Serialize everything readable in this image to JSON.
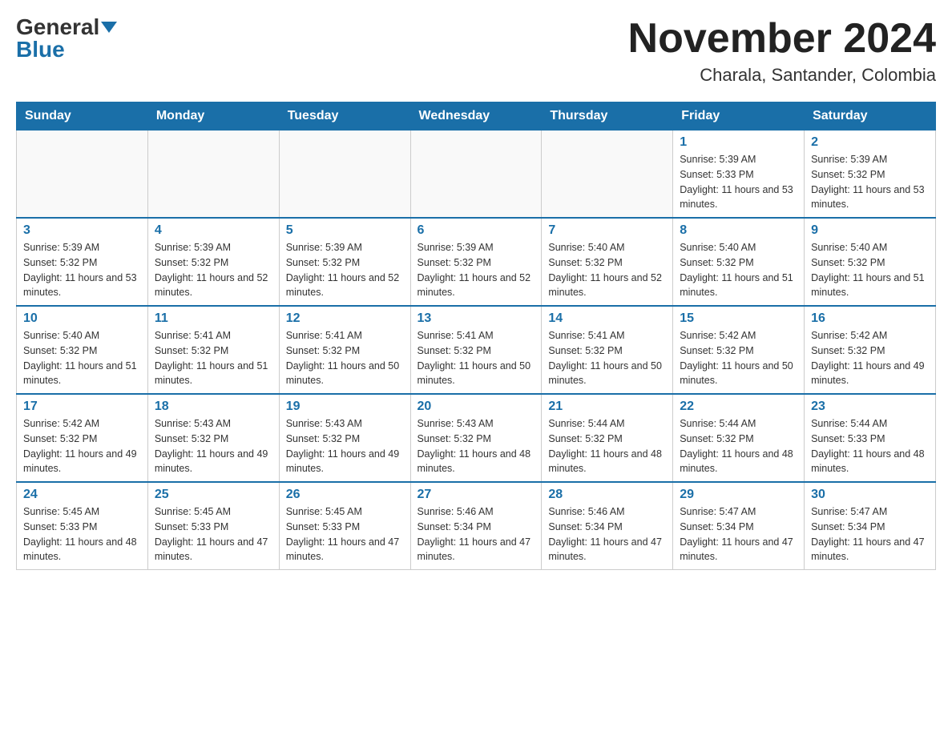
{
  "header": {
    "logo_general": "General",
    "logo_blue": "Blue",
    "month_title": "November 2024",
    "location": "Charala, Santander, Colombia"
  },
  "days_of_week": [
    "Sunday",
    "Monday",
    "Tuesday",
    "Wednesday",
    "Thursday",
    "Friday",
    "Saturday"
  ],
  "weeks": [
    [
      {
        "day": "",
        "info": ""
      },
      {
        "day": "",
        "info": ""
      },
      {
        "day": "",
        "info": ""
      },
      {
        "day": "",
        "info": ""
      },
      {
        "day": "",
        "info": ""
      },
      {
        "day": "1",
        "info": "Sunrise: 5:39 AM\nSunset: 5:33 PM\nDaylight: 11 hours and 53 minutes."
      },
      {
        "day": "2",
        "info": "Sunrise: 5:39 AM\nSunset: 5:32 PM\nDaylight: 11 hours and 53 minutes."
      }
    ],
    [
      {
        "day": "3",
        "info": "Sunrise: 5:39 AM\nSunset: 5:32 PM\nDaylight: 11 hours and 53 minutes."
      },
      {
        "day": "4",
        "info": "Sunrise: 5:39 AM\nSunset: 5:32 PM\nDaylight: 11 hours and 52 minutes."
      },
      {
        "day": "5",
        "info": "Sunrise: 5:39 AM\nSunset: 5:32 PM\nDaylight: 11 hours and 52 minutes."
      },
      {
        "day": "6",
        "info": "Sunrise: 5:39 AM\nSunset: 5:32 PM\nDaylight: 11 hours and 52 minutes."
      },
      {
        "day": "7",
        "info": "Sunrise: 5:40 AM\nSunset: 5:32 PM\nDaylight: 11 hours and 52 minutes."
      },
      {
        "day": "8",
        "info": "Sunrise: 5:40 AM\nSunset: 5:32 PM\nDaylight: 11 hours and 51 minutes."
      },
      {
        "day": "9",
        "info": "Sunrise: 5:40 AM\nSunset: 5:32 PM\nDaylight: 11 hours and 51 minutes."
      }
    ],
    [
      {
        "day": "10",
        "info": "Sunrise: 5:40 AM\nSunset: 5:32 PM\nDaylight: 11 hours and 51 minutes."
      },
      {
        "day": "11",
        "info": "Sunrise: 5:41 AM\nSunset: 5:32 PM\nDaylight: 11 hours and 51 minutes."
      },
      {
        "day": "12",
        "info": "Sunrise: 5:41 AM\nSunset: 5:32 PM\nDaylight: 11 hours and 50 minutes."
      },
      {
        "day": "13",
        "info": "Sunrise: 5:41 AM\nSunset: 5:32 PM\nDaylight: 11 hours and 50 minutes."
      },
      {
        "day": "14",
        "info": "Sunrise: 5:41 AM\nSunset: 5:32 PM\nDaylight: 11 hours and 50 minutes."
      },
      {
        "day": "15",
        "info": "Sunrise: 5:42 AM\nSunset: 5:32 PM\nDaylight: 11 hours and 50 minutes."
      },
      {
        "day": "16",
        "info": "Sunrise: 5:42 AM\nSunset: 5:32 PM\nDaylight: 11 hours and 49 minutes."
      }
    ],
    [
      {
        "day": "17",
        "info": "Sunrise: 5:42 AM\nSunset: 5:32 PM\nDaylight: 11 hours and 49 minutes."
      },
      {
        "day": "18",
        "info": "Sunrise: 5:43 AM\nSunset: 5:32 PM\nDaylight: 11 hours and 49 minutes."
      },
      {
        "day": "19",
        "info": "Sunrise: 5:43 AM\nSunset: 5:32 PM\nDaylight: 11 hours and 49 minutes."
      },
      {
        "day": "20",
        "info": "Sunrise: 5:43 AM\nSunset: 5:32 PM\nDaylight: 11 hours and 48 minutes."
      },
      {
        "day": "21",
        "info": "Sunrise: 5:44 AM\nSunset: 5:32 PM\nDaylight: 11 hours and 48 minutes."
      },
      {
        "day": "22",
        "info": "Sunrise: 5:44 AM\nSunset: 5:32 PM\nDaylight: 11 hours and 48 minutes."
      },
      {
        "day": "23",
        "info": "Sunrise: 5:44 AM\nSunset: 5:33 PM\nDaylight: 11 hours and 48 minutes."
      }
    ],
    [
      {
        "day": "24",
        "info": "Sunrise: 5:45 AM\nSunset: 5:33 PM\nDaylight: 11 hours and 48 minutes."
      },
      {
        "day": "25",
        "info": "Sunrise: 5:45 AM\nSunset: 5:33 PM\nDaylight: 11 hours and 47 minutes."
      },
      {
        "day": "26",
        "info": "Sunrise: 5:45 AM\nSunset: 5:33 PM\nDaylight: 11 hours and 47 minutes."
      },
      {
        "day": "27",
        "info": "Sunrise: 5:46 AM\nSunset: 5:34 PM\nDaylight: 11 hours and 47 minutes."
      },
      {
        "day": "28",
        "info": "Sunrise: 5:46 AM\nSunset: 5:34 PM\nDaylight: 11 hours and 47 minutes."
      },
      {
        "day": "29",
        "info": "Sunrise: 5:47 AM\nSunset: 5:34 PM\nDaylight: 11 hours and 47 minutes."
      },
      {
        "day": "30",
        "info": "Sunrise: 5:47 AM\nSunset: 5:34 PM\nDaylight: 11 hours and 47 minutes."
      }
    ]
  ]
}
